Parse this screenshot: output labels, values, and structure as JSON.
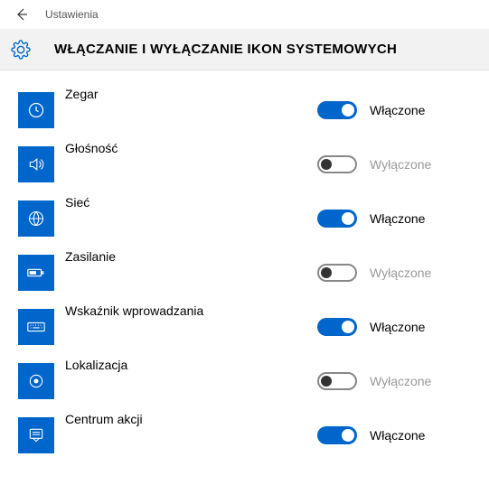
{
  "titlebar": {
    "app_name": "Ustawienia"
  },
  "header": {
    "title": "WŁĄCZANIE I WYŁĄCZANIE IKON SYSTEMOWYCH"
  },
  "status_labels": {
    "on": "Włączone",
    "off": "Wyłączone"
  },
  "items": [
    {
      "label": "Zegar",
      "on": true,
      "icon": "clock"
    },
    {
      "label": "Głośność",
      "on": false,
      "icon": "volume"
    },
    {
      "label": "Sieć",
      "on": true,
      "icon": "globe"
    },
    {
      "label": "Zasilanie",
      "on": false,
      "icon": "battery"
    },
    {
      "label": "Wskaźnik wprowadzania",
      "on": true,
      "icon": "keyboard"
    },
    {
      "label": "Lokalizacja",
      "on": false,
      "icon": "location"
    },
    {
      "label": "Centrum akcji",
      "on": true,
      "icon": "action"
    }
  ]
}
